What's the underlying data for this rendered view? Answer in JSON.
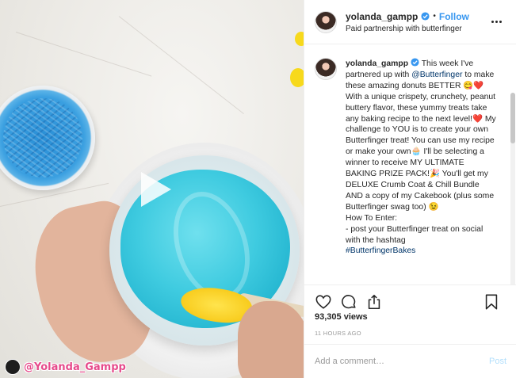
{
  "media": {
    "watermark_text": "@Yolanda_Gampp",
    "play_icon": "play-icon"
  },
  "header": {
    "username": "yolanda_gampp",
    "verified_icon": "verified-badge-icon",
    "separator": "•",
    "follow_label": "Follow",
    "subtitle": "Paid partnership with butterfinger",
    "more_icon": "more-options-icon"
  },
  "caption": {
    "username": "yolanda_gampp",
    "segments": {
      "s1": "This week I've partnered up with ",
      "mention": "@Butterfinger",
      "s2": " to make these amazing donuts BETTER 😋❤️ With a unique crispety, crunchety, peanut buttery flavor, these yummy treats take any baking recipe to the next level!❤️ My challenge to YOU is to create your own Butterfinger treat! You can use my recipe or make your own🧁 I'll be selecting a winner to receive MY ULTIMATE BAKING PRIZE PACK!🎉 You'll get my DELUXE Crumb Coat & Chill Bundle AND a copy of my Cakebook (plus some Butterfinger swag too) 😉",
      "how_to": "How To Enter:",
      "step1": "- post your Butterfinger treat on social with the hashtag",
      "hashtag": "#ButterfingerBakes"
    }
  },
  "actions": {
    "like_icon": "heart-icon",
    "comment_icon": "comment-icon",
    "share_icon": "share-icon",
    "save_icon": "bookmark-icon"
  },
  "stats": {
    "views": "93,305 views",
    "timestamp": "11 HOURS AGO"
  },
  "comment_box": {
    "placeholder": "Add a comment…",
    "post_label": "Post"
  },
  "colors": {
    "link_blue": "#3897f0",
    "mention_blue": "#003569",
    "post_disabled": "#b2dffc",
    "frosting": "#3fcbe0",
    "watermark": "#e64a8b"
  }
}
